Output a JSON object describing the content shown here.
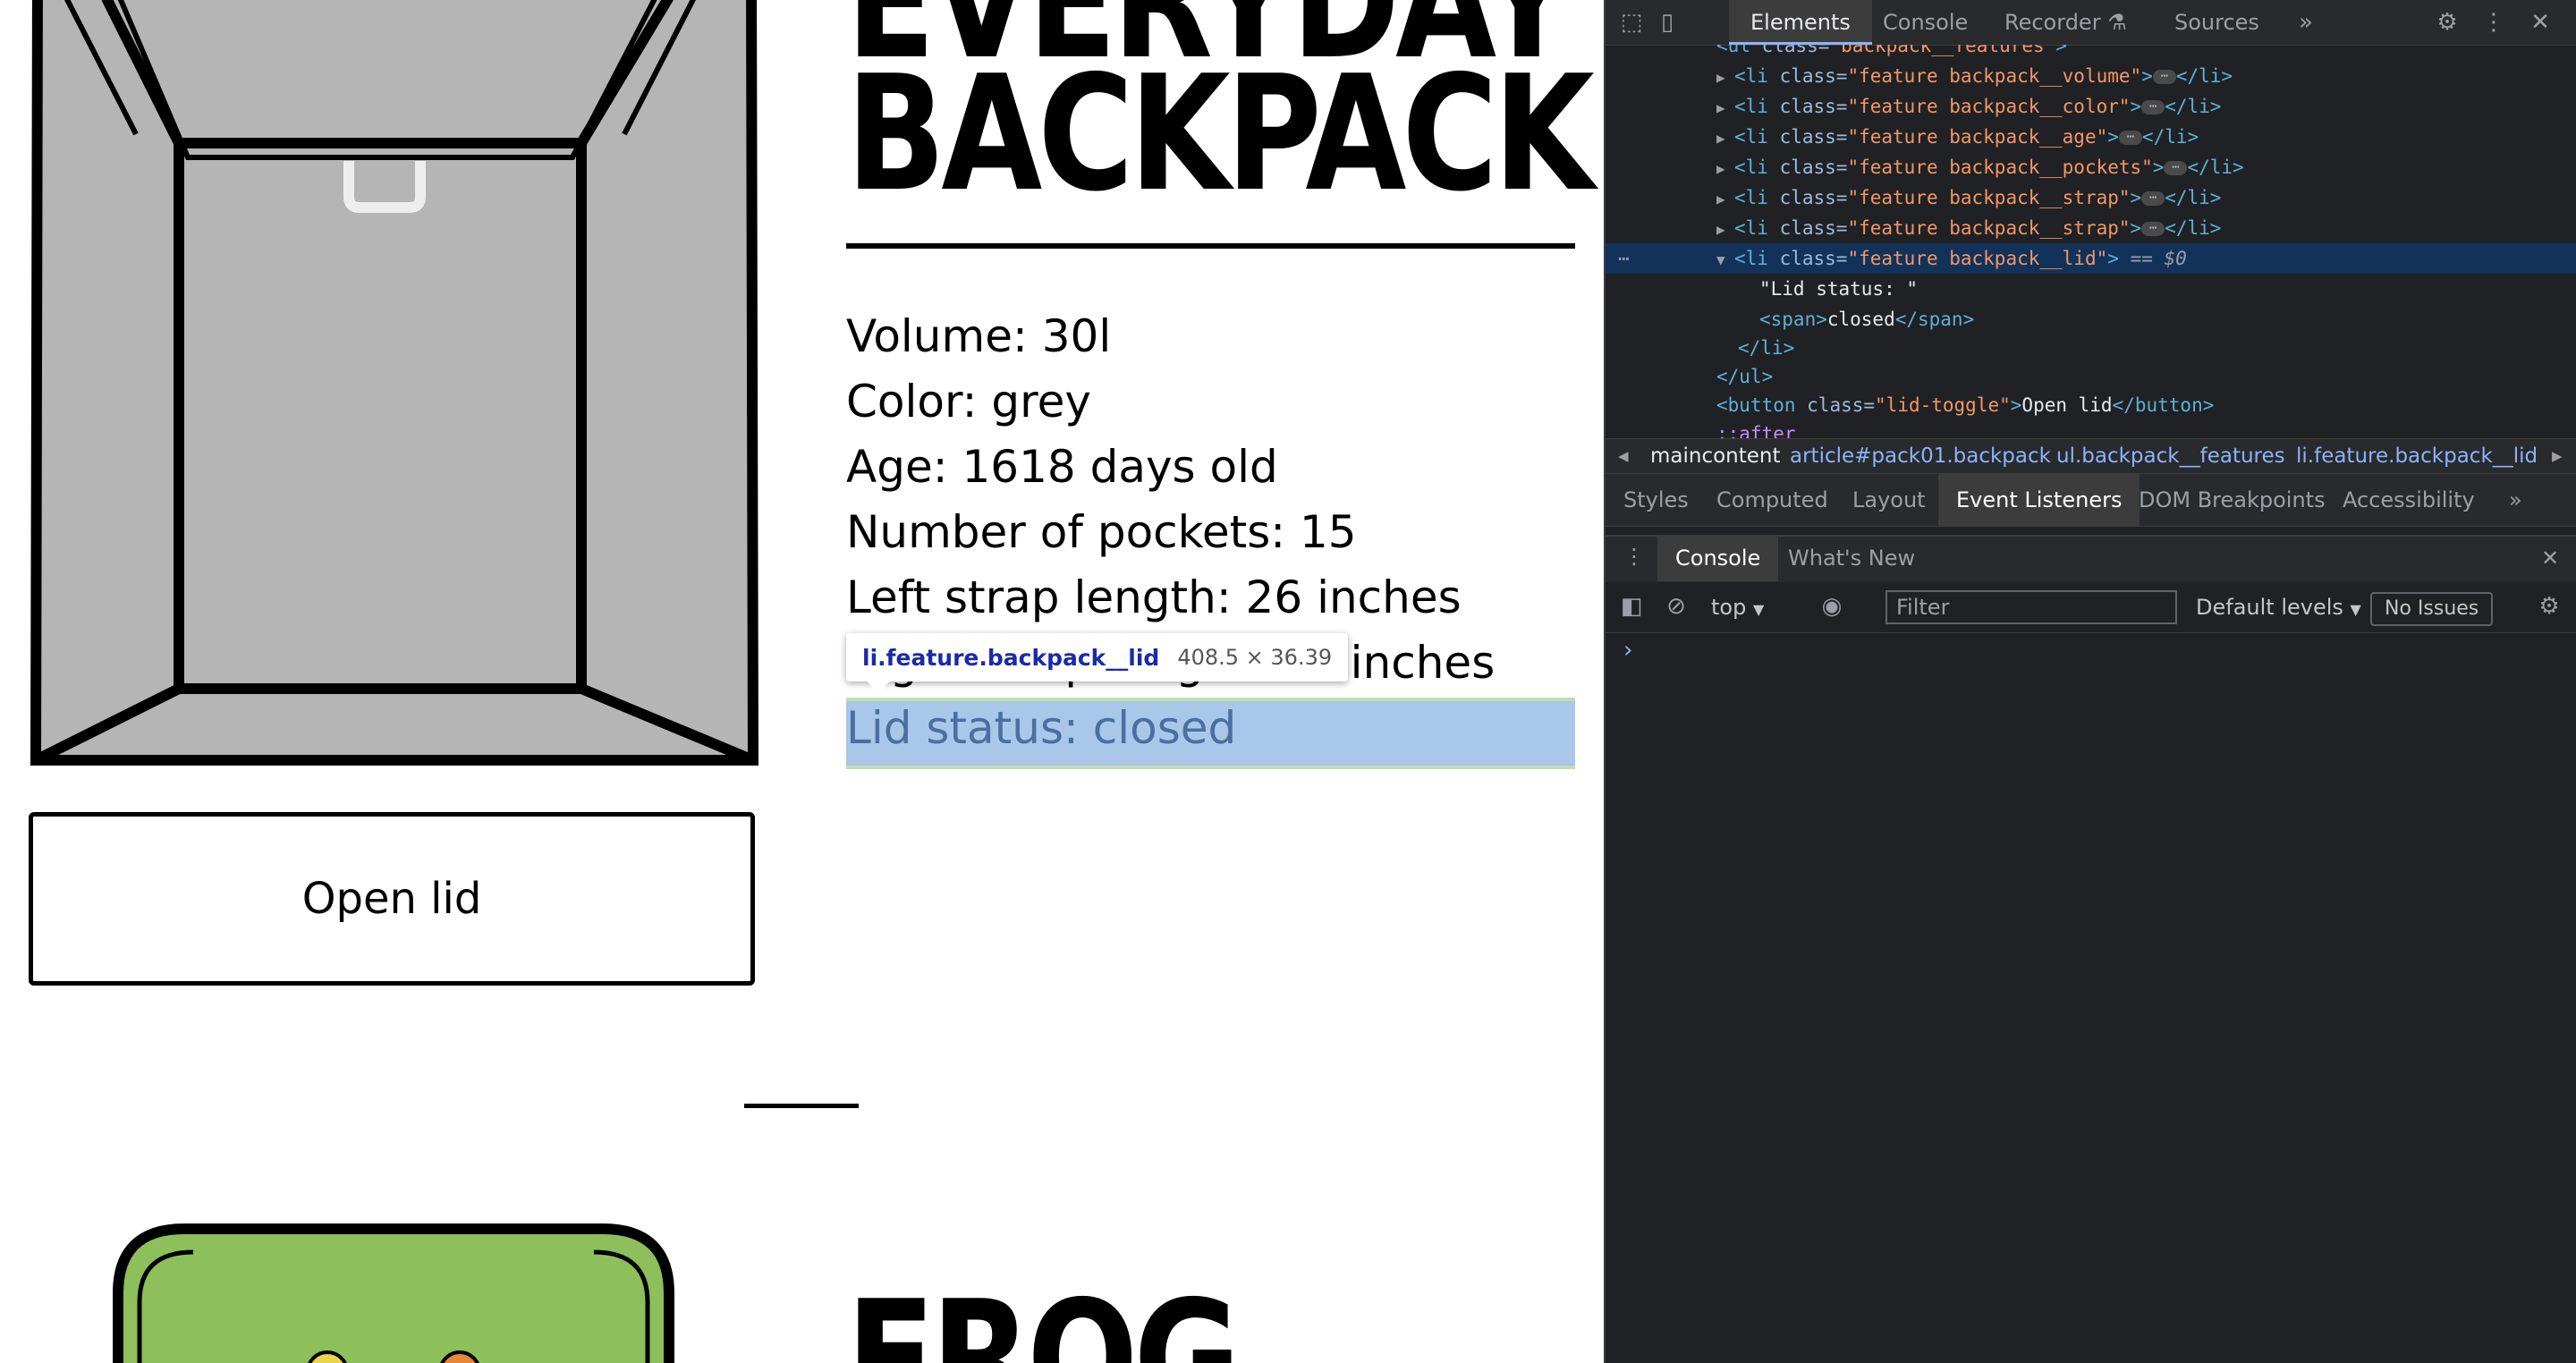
{
  "page": {
    "title_line1": "EVERYDAY",
    "title_line2": "BACKPACK",
    "features": [
      "Volume: 30l",
      "Color: grey",
      "Age: 1618 days old",
      "Number of pockets: 15",
      "Left strap length: 26 inches",
      "Right strap length: 26 inches",
      "Lid status: closed"
    ],
    "open_button": "Open lid",
    "second_title": "FROG",
    "tooltip_selector": "li.feature.backpack__lid",
    "tooltip_size": "408.5 × 36.39"
  },
  "devtools": {
    "tabs": [
      "Elements",
      "Console",
      "Recorder",
      "Sources"
    ],
    "active_tab": "Elements",
    "dom_lines": [
      {
        "tag": "ul",
        "cls": "backpack__features"
      },
      {
        "tag": "li",
        "cls": "feature backpack__volume"
      },
      {
        "tag": "li",
        "cls": "feature backpack__color"
      },
      {
        "tag": "li",
        "cls": "feature backpack__age"
      },
      {
        "tag": "li",
        "cls": "feature backpack__pockets"
      },
      {
        "tag": "li",
        "cls": "feature backpack__strap"
      },
      {
        "tag": "li",
        "cls": "feature backpack__strap"
      },
      {
        "tag": "li",
        "cls": "feature backpack__lid",
        "selected_marker": "== $0"
      },
      {
        "text": "\"Lid status: \""
      },
      {
        "span_text": "closed"
      },
      {
        "close": "</li>"
      },
      {
        "close": "</ul>"
      },
      {
        "button_class": "lid-toggle",
        "button_text": "Open lid"
      },
      {
        "pseudo": "::after"
      }
    ],
    "breadcrumbs": [
      "maincontent",
      "article#pack01.backpack",
      "ul.backpack__features",
      "li.feature.backpack__lid"
    ],
    "sub_tabs": [
      "Styles",
      "Computed",
      "Layout",
      "Event Listeners",
      "DOM Breakpoints",
      "Accessibility"
    ],
    "active_sub_tab": "Event Listeners",
    "drawer_tabs": [
      "Console",
      "What's New"
    ],
    "active_drawer_tab": "Console",
    "context": "top",
    "filter_placeholder": "Filter",
    "levels": "Default levels",
    "issues": "No Issues",
    "prompt": "›"
  },
  "colors": {
    "highlight": "#6fa1db",
    "devtools_bg": "#202124",
    "tag_color": "#5db0d7",
    "attr_value": "#f29766"
  }
}
